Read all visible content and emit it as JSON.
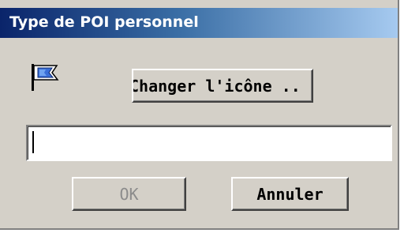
{
  "window": {
    "title": "Type de POI personnel"
  },
  "icon": {
    "name": "blue-flag-icon",
    "flag_color": "#3a6fd8"
  },
  "buttons": {
    "change_icon_label": "Changer l'icône ..",
    "ok_label": "OK",
    "cancel_label": "Annuler"
  },
  "name_field": {
    "value": "",
    "placeholder": ""
  },
  "colors": {
    "titlebar_start": "#0a246a",
    "titlebar_end": "#a6caf0",
    "face": "#d4d0c8"
  }
}
